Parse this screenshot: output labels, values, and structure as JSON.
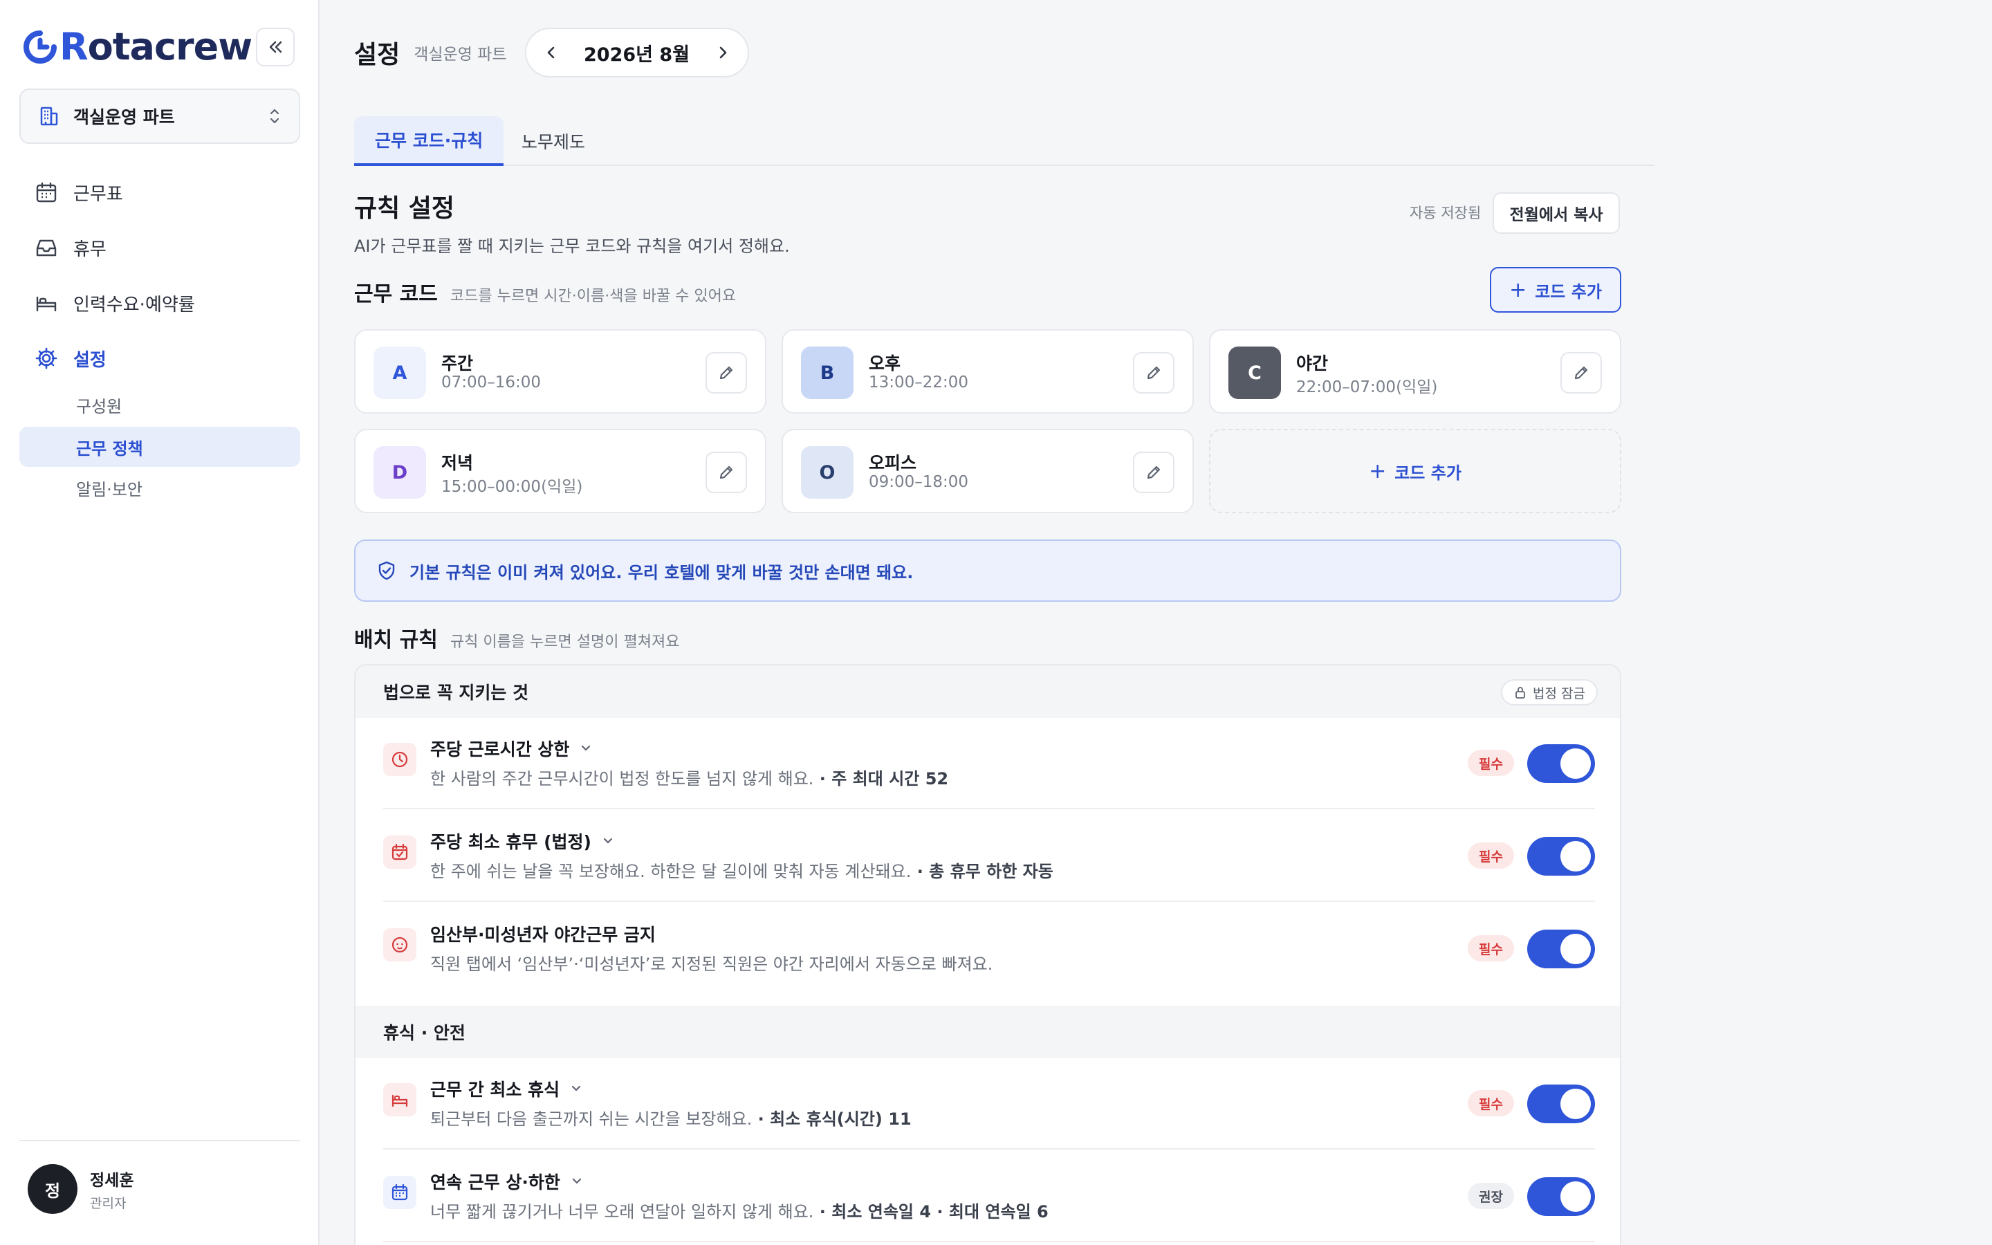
{
  "app": {
    "logo_prefix": "R",
    "logo_rest": "otacrew",
    "accent_color": "#2f56d9"
  },
  "sidebar": {
    "team": "객실운영 파트",
    "nav": [
      {
        "label": "근무표",
        "icon": "calendar-icon"
      },
      {
        "label": "휴무",
        "icon": "inbox-icon"
      },
      {
        "label": "인력수요·예약률",
        "icon": "bed-icon"
      },
      {
        "label": "설정",
        "icon": "gear-icon"
      }
    ],
    "sub": [
      {
        "label": "구성원"
      },
      {
        "label": "근무 정책"
      },
      {
        "label": "알림·보안"
      }
    ],
    "user": {
      "initial": "정",
      "name": "정세훈",
      "role": "관리자"
    }
  },
  "header": {
    "title": "설정",
    "subtitle": "객실운영 파트",
    "month": "2026년 8월"
  },
  "tabs": [
    {
      "label": "근무 코드·규칙"
    },
    {
      "label": "노무제도"
    }
  ],
  "rules_settings": {
    "title": "규칙 설정",
    "desc": "AI가 근무표를 짤 때 지키는 근무 코드와 규칙을 여기서 정해요.",
    "autosave": "자동 저장됨",
    "copy_button": "전월에서 복사"
  },
  "codes": {
    "title": "근무 코드",
    "desc": "코드를 누르면 시간·이름·색을 바꿀 수 있어요",
    "add_button": "코드 추가",
    "items": [
      {
        "code": "A",
        "name": "주간",
        "time": "07:00–16:00",
        "bg": "#eef2fd",
        "fg": "#2f56d9"
      },
      {
        "code": "B",
        "name": "오후",
        "time": "13:00–22:00",
        "bg": "#c9d7f7",
        "fg": "#1e3a8a"
      },
      {
        "code": "C",
        "name": "야간",
        "time": "22:00–07:00(익일)",
        "bg": "#555a64",
        "fg": "#ffffff"
      },
      {
        "code": "D",
        "name": "저녁",
        "time": "15:00–00:00(익일)",
        "bg": "#efeafd",
        "fg": "#6b3fc8"
      },
      {
        "code": "O",
        "name": "오피스",
        "time": "09:00–18:00",
        "bg": "#dfe7f7",
        "fg": "#2a3f6e"
      }
    ],
    "add_card": "코드 추가"
  },
  "banner": "기본 규칙은 이미 켜져 있어요. 우리 호텔에 맞게 바꿀 것만 손대면 돼요.",
  "placement": {
    "title": "배치 규칙",
    "desc": "규칙 이름을 누르면 설명이 펼쳐져요",
    "groups": [
      {
        "title": "법으로 꼭 지키는 것",
        "lock": "법정 잠금",
        "rules": [
          {
            "title": "주당 근로시간 상한",
            "desc": "한 사람의 주간 근무시간이 법정 한도를 넘지 않게 해요.",
            "extra": " · 주 최대 시간 52",
            "badge": "필수",
            "on": true
          },
          {
            "title": "주당 최소 휴무 (법정)",
            "desc": "한 주에 쉬는 날을 꼭 보장해요. 하한은 달 길이에 맞춰 자동 계산돼요.",
            "extra": " · 총 휴무 하한 자동",
            "badge": "필수",
            "on": true
          },
          {
            "title": "임산부·미성년자 야간근무 금지",
            "desc": "직원 탭에서 ‘임산부’·‘미성년자’로 지정된 직원은 야간 자리에서 자동으로 빠져요.",
            "extra": "",
            "badge": "필수",
            "on": true
          }
        ]
      },
      {
        "title": "휴식 · 안전",
        "rules": [
          {
            "title": "근무 간 최소 휴식",
            "desc": "퇴근부터 다음 출근까지 쉬는 시간을 보장해요.",
            "extra": " · 최소 휴식(시간) 11",
            "badge": "필수",
            "on": true
          },
          {
            "title": "연속 근무 상·하한",
            "desc": "너무 짧게 끊기거나 너무 오래 연달아 일하지 않게 해요.",
            "extra": " · 최소 연속일 4 · 최대 연속일 6",
            "badge": "권장",
            "on": true
          }
        ]
      }
    ]
  }
}
